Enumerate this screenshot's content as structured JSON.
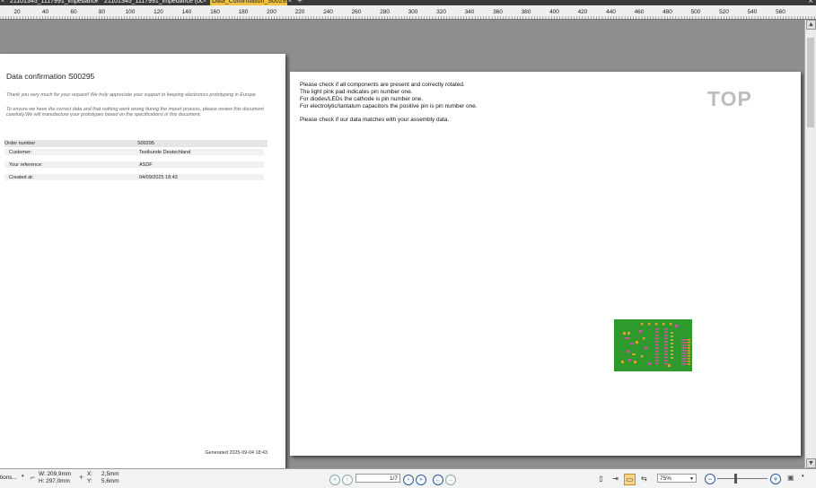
{
  "tabs": [
    {
      "label": "21101345_1117991_impedance",
      "active": false
    },
    {
      "label": "21101345_1117991_impedance (002)",
      "active": false
    },
    {
      "label": "Data_Confirmation_S00295",
      "active": true
    }
  ],
  "ruler": {
    "labels": [
      "20",
      "40",
      "60",
      "80",
      "100",
      "120",
      "140",
      "160",
      "180",
      "200",
      "220",
      "240",
      "260",
      "280",
      "300",
      "320",
      "340",
      "360",
      "380",
      "400",
      "420",
      "440",
      "460",
      "480",
      "500",
      "520",
      "540",
      "560"
    ]
  },
  "page1": {
    "title": "Data confirmation S00295",
    "intro_1": "Thank you very much for your request! We truly appreciate your support in keeping electronics prototyping in Europe.",
    "intro_2": "To ensure we have the correct data and that nothing went wrong during the import process, please review this document carefully.We will manufacture your prototypes based on the specifications in this document.",
    "order_header": {
      "key": "Order number",
      "value": "S00295"
    },
    "rows": [
      {
        "key": "Customer:",
        "value": "Testkunde Deutschland"
      },
      {
        "key": "Your reference:",
        "value": "ASDF"
      },
      {
        "key": "Created at:",
        "value": "04/09/2025 18:43"
      }
    ],
    "generated": "Generated 2025-09-04 18:43"
  },
  "page2": {
    "instructions": [
      "Please check if all components are present and correctly rotated.",
      "The light pink pad indicates pin number one.",
      "For diodes/LEDs the cathode is pin number one.",
      "For electrolytic/tantalum capacitors the positive pin is pin number one."
    ],
    "match_note": "Please check if our data matches with your assembly data.",
    "side_label": "TOP"
  },
  "status": {
    "options_label": "tions...",
    "width": "W: 209,9mm",
    "height": "H: 297,0mm",
    "x": "X:",
    "x_value": "2,5mm",
    "y": "Y:",
    "y_value": "5,6mm",
    "page": "1/7",
    "zoom": "75%"
  },
  "colors": {
    "pcb_green": "#2e9a2e",
    "pad_pink": "#c05a9a",
    "pad_gold": "#d8a628",
    "active_tab": "#f0c040"
  }
}
